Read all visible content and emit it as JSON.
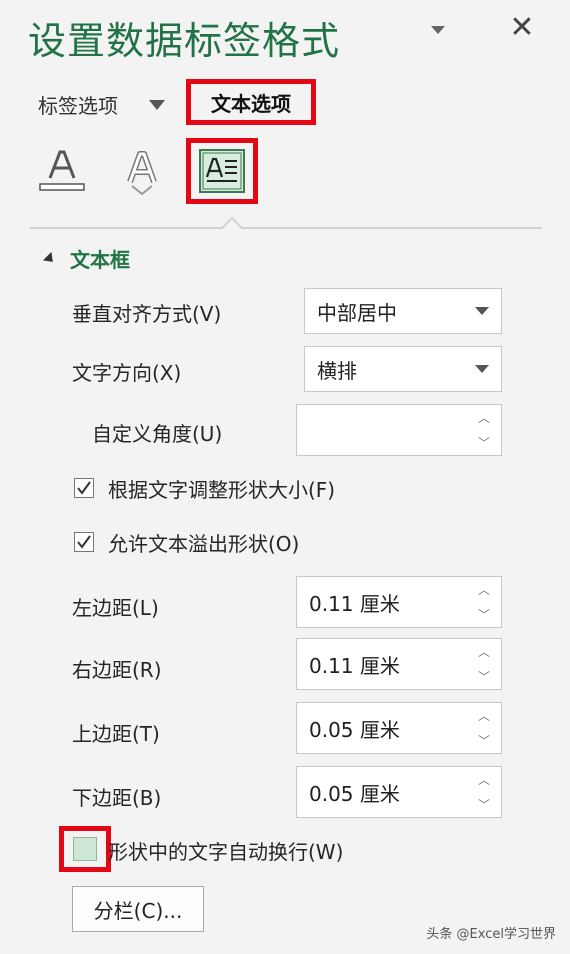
{
  "pane": {
    "title": "设置数据标签格式",
    "close_glyph": "✕"
  },
  "tabs": [
    {
      "label": "标签选项",
      "active": false
    },
    {
      "label": "文本选项",
      "active": true
    }
  ],
  "icons": [
    "text-fill-outline-icon",
    "text-effects-icon",
    "textbox-icon"
  ],
  "section": {
    "title": "文本框",
    "expanded": true
  },
  "fields": {
    "vertical_align": {
      "label": "垂直对齐方式(V)",
      "value": "中部居中"
    },
    "text_direction": {
      "label": "文字方向(X)",
      "value": "横排"
    },
    "custom_angle": {
      "label": "自定义角度(U)",
      "value": ""
    },
    "resize_shape": {
      "label": "根据文字调整形状大小(F)",
      "checked": true
    },
    "allow_overflow": {
      "label": "允许文本溢出形状(O)",
      "checked": true
    },
    "left_margin": {
      "label": "左边距(L)",
      "value": "0.11 厘米"
    },
    "right_margin": {
      "label": "右边距(R)",
      "value": "0.11 厘米"
    },
    "top_margin": {
      "label": "上边距(T)",
      "value": "0.05 厘米"
    },
    "bottom_margin": {
      "label": "下边距(B)",
      "value": "0.05 厘米"
    },
    "wrap_text": {
      "label": "形状中的文字自动换行(W)",
      "checked": false
    }
  },
  "columns_button": "分栏(C)...",
  "watermark": "头条 @Excel学习世界",
  "colors": {
    "accent": "#217346",
    "highlight": "#e30613",
    "background": "#f3f3f3"
  }
}
